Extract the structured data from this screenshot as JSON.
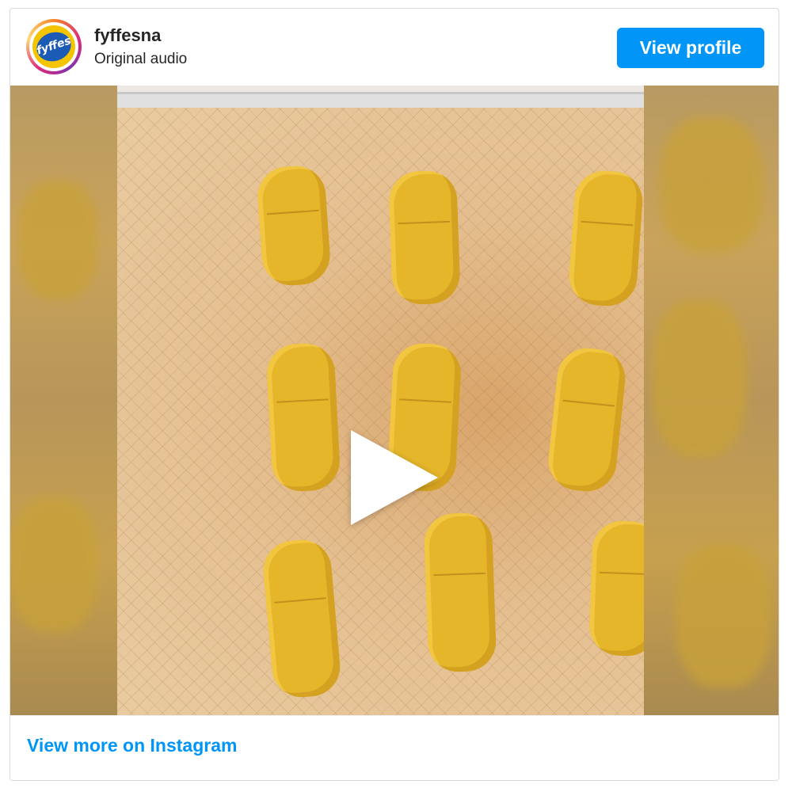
{
  "header": {
    "username": "fyffesna",
    "subtitle": "Original audio",
    "avatar_logo": "fyffes",
    "view_profile_label": "View profile"
  },
  "media": {
    "play_icon": "play-icon"
  },
  "footer": {
    "view_more_label": "View more on Instagram"
  },
  "colors": {
    "accent": "#0095f6",
    "text": "#262626",
    "border": "#dbdbdb"
  }
}
